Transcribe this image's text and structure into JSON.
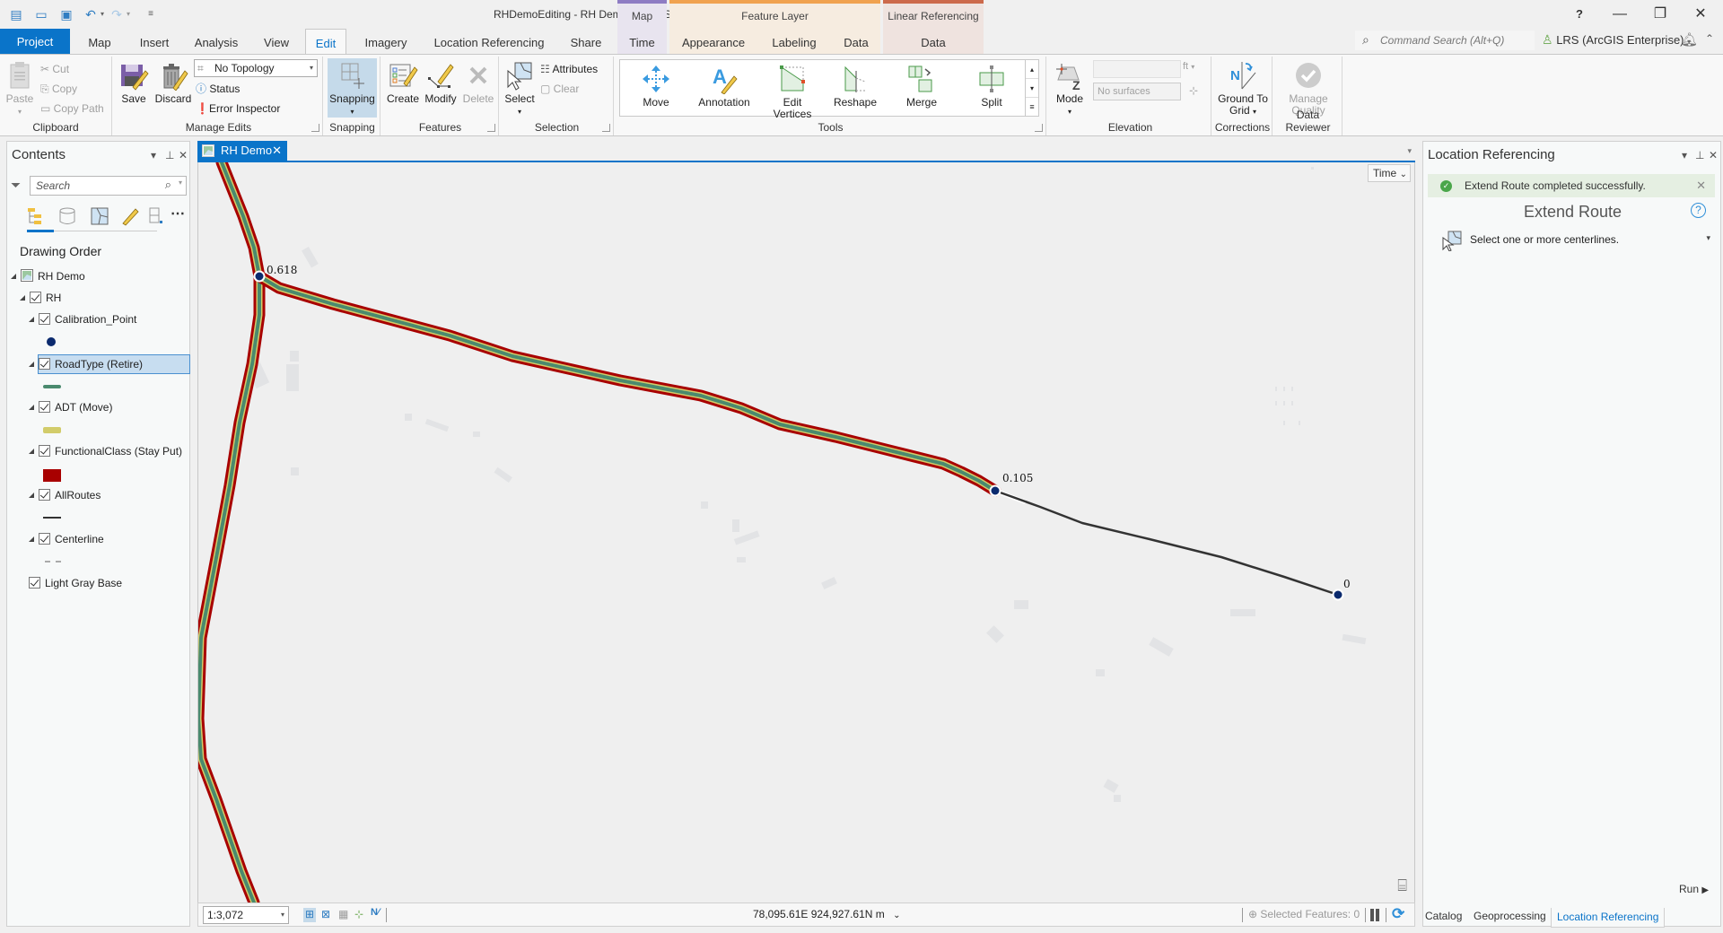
{
  "app": {
    "title": "RHDemoEditing - RH Demo - ArcGIS Pro",
    "window_controls": {
      "help": "?",
      "minimize": "—",
      "restore": "❐",
      "close": "✕"
    }
  },
  "quick_access": [
    "new-project-icon",
    "open-project-icon",
    "save-project-icon",
    "undo-icon",
    "redo-icon",
    "customize-icon"
  ],
  "tabs": [
    {
      "label": "Project",
      "state": "project"
    },
    {
      "label": "Map"
    },
    {
      "label": "Insert"
    },
    {
      "label": "Analysis"
    },
    {
      "label": "View"
    },
    {
      "label": "Edit",
      "state": "active"
    },
    {
      "label": "Imagery"
    },
    {
      "label": "Location Referencing"
    },
    {
      "label": "Share"
    }
  ],
  "contextual_tabs": [
    {
      "group": "Map",
      "color": "#8e7cc3",
      "bg": "#e8e4ef",
      "tabs": [
        "Time"
      ]
    },
    {
      "group": "Feature Layer",
      "color": "#f0a24f",
      "bg": "#f6ece0",
      "tabs": [
        "Appearance",
        "Labeling",
        "Data"
      ]
    },
    {
      "group": "Linear Referencing",
      "color": "#cc6a4c",
      "bg": "#efe3df",
      "tabs": [
        "Data"
      ]
    }
  ],
  "command_search": {
    "placeholder": "Command Search (Alt+Q)"
  },
  "portal": {
    "label": "LRS (ArcGIS Enterprise)"
  },
  "ribbon": {
    "clipboard": {
      "label": "Clipboard",
      "paste": "Paste",
      "cut": "Cut",
      "copy": "Copy",
      "copy_path": "Copy Path"
    },
    "manage_edits": {
      "label": "Manage Edits",
      "save": "Save",
      "discard": "Discard",
      "topology": "No Topology",
      "status": "Status",
      "error_inspector": "Error Inspector"
    },
    "snapping": {
      "label": "Snapping",
      "button": "Snapping"
    },
    "features": {
      "label": "Features",
      "create": "Create",
      "modify": "Modify",
      "delete": "Delete"
    },
    "selection": {
      "label": "Selection",
      "select": "Select",
      "attributes": "Attributes",
      "clear": "Clear"
    },
    "tools": {
      "label": "Tools",
      "items": [
        "Move",
        "Annotation",
        "Edit Vertices",
        "Reshape",
        "Merge",
        "Split"
      ]
    },
    "elevation": {
      "label": "Elevation",
      "mode": "Mode",
      "unit": "ft",
      "surfaces": "No surfaces"
    },
    "corrections": {
      "label": "Corrections",
      "ground_to_grid": "Ground To Grid"
    },
    "data_reviewer": {
      "label": "Data Reviewer",
      "manage_quality": "Manage Quality"
    }
  },
  "contents": {
    "title": "Contents",
    "search_placeholder": "Search",
    "heading": "Drawing Order",
    "layers": [
      {
        "name": "RH Demo",
        "level": 0,
        "type": "map"
      },
      {
        "name": "RH",
        "level": 1,
        "checked": true
      },
      {
        "name": "Calibration_Point",
        "level": 2,
        "checked": true,
        "symbol": "point",
        "color": "#0b2a6e"
      },
      {
        "name": "RoadType (Retire)",
        "level": 2,
        "checked": true,
        "selected": true,
        "symbol": "line",
        "color": "#4a8a6e"
      },
      {
        "name": "ADT (Move)",
        "level": 2,
        "checked": true,
        "symbol": "line",
        "color": "#d2cc6a"
      },
      {
        "name": "FunctionalClass (Stay Put)",
        "level": 2,
        "checked": true,
        "symbol": "fill",
        "color": "#a80000"
      },
      {
        "name": "AllRoutes",
        "level": 2,
        "checked": true,
        "symbol": "line",
        "color": "#333333"
      },
      {
        "name": "Centerline",
        "level": 2,
        "checked": true,
        "symbol": "dash",
        "color": "#9a9a9a"
      },
      {
        "name": "Light Gray Base",
        "level": 1,
        "checked": true,
        "noexpand": true
      }
    ]
  },
  "map": {
    "tab_label": "RH Demo",
    "time_button": "Time",
    "labels": [
      {
        "text": "0.618"
      },
      {
        "text": "0.105"
      },
      {
        "text": "0"
      }
    ],
    "scale": "1:3,072",
    "coordinates": "78,095.61E 924,927.61N m",
    "selected_features": "Selected Features: 0"
  },
  "location_referencing": {
    "title": "Location Referencing",
    "message": "Extend Route completed successfully.",
    "tool_title": "Extend Route",
    "instruction": "Select one or more centerlines.",
    "run": "Run"
  },
  "bottom_tabs": [
    "Catalog",
    "Geoprocessing",
    "Location Referencing"
  ]
}
